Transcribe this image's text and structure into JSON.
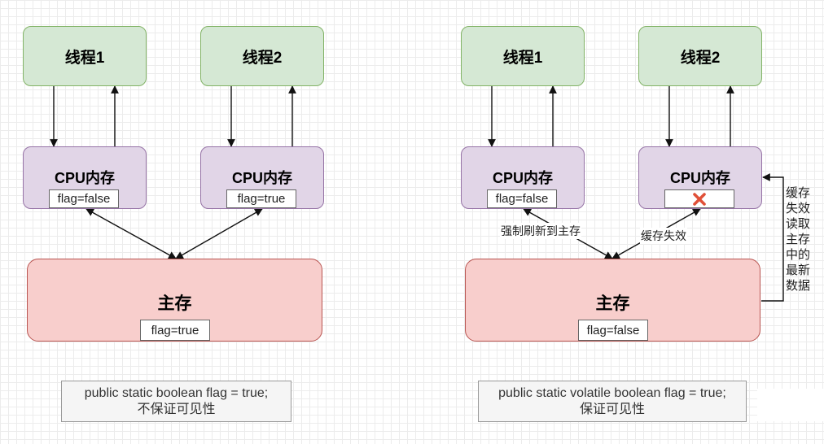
{
  "left": {
    "thread1": "线程1",
    "thread2": "线程2",
    "cpu1": {
      "title": "CPU内存",
      "flag": "flag=false"
    },
    "cpu2": {
      "title": "CPU内存",
      "flag": "flag=true"
    },
    "main_memory": {
      "title": "主存",
      "flag": "flag=true"
    },
    "code_line1": "public static boolean flag = true;",
    "code_line2": "不保证可见性"
  },
  "right": {
    "thread1": "线程1",
    "thread2": "线程2",
    "cpu1": {
      "title": "CPU内存",
      "flag": "flag=false"
    },
    "cpu2": {
      "title": "CPU内存",
      "invalid_icon": "x-icon"
    },
    "main_memory": {
      "title": "主存",
      "flag": "flag=false"
    },
    "label_flush": "强制刷新到主存",
    "label_invalidate": "缓存失效",
    "side_label_chars": [
      "缓存",
      "失效",
      "读取",
      "主存",
      "中的",
      "最新",
      "数据"
    ],
    "code_line1": "public static volatile boolean flag = true;",
    "code_line2": "保证可见性"
  },
  "colors": {
    "thread_fill": "#d5e8d4",
    "thread_stroke": "#82b366",
    "cpu_fill": "#e1d5e7",
    "cpu_stroke": "#9673a6",
    "memory_fill": "#f8cecc",
    "memory_stroke": "#b85450",
    "invalid_mark": "#e05038"
  }
}
